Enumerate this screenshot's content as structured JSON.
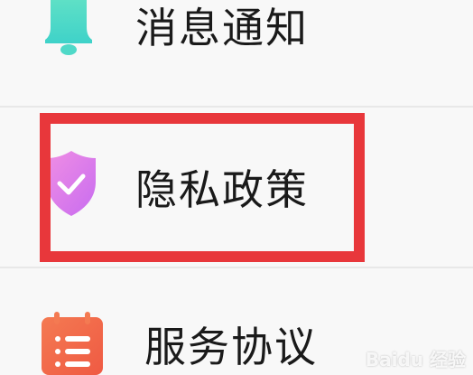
{
  "menu": {
    "items": [
      {
        "label": "消息通知",
        "icon": "bell-icon",
        "icon_color": "#4fd9c8"
      },
      {
        "label": "隐私政策",
        "icon": "shield-icon",
        "icon_color": "#e97be8"
      },
      {
        "label": "服务协议",
        "icon": "document-list-icon",
        "icon_color": "#f2684a"
      }
    ]
  },
  "highlight": {
    "color": "#e8373b"
  },
  "watermark": {
    "text": "Baidu 经验"
  }
}
